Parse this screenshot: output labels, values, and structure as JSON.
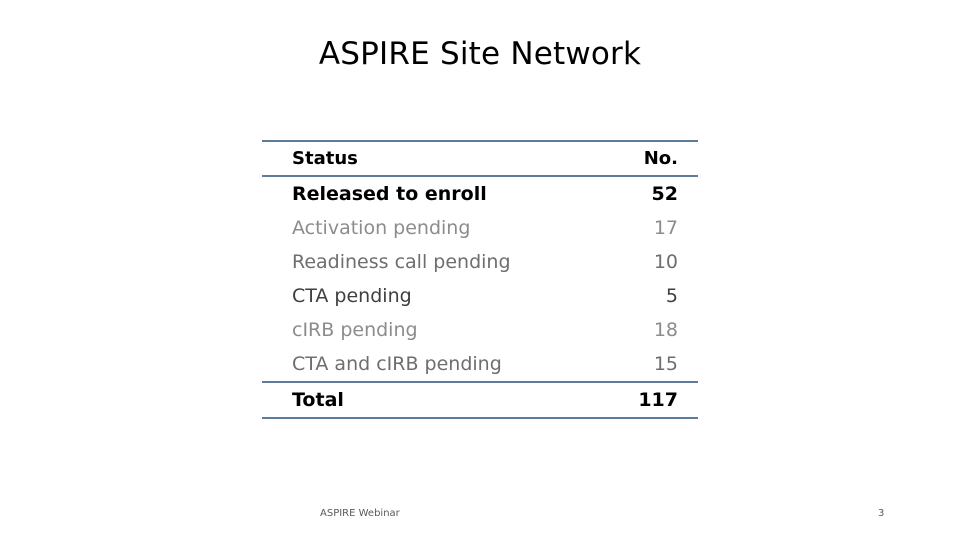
{
  "slide": {
    "title": "ASPIRE Site Network",
    "background_color": "#FFFFFF",
    "rule_color": "#5B7C9D"
  },
  "table": {
    "columns": [
      {
        "key": "status",
        "label": "Status",
        "align": "left"
      },
      {
        "key": "no",
        "label": "No.",
        "align": "right"
      }
    ],
    "rows": [
      {
        "status": "Released to enroll",
        "no": "52",
        "emphasis": "bold",
        "color": "#000000"
      },
      {
        "status": "Activation pending",
        "no": "17",
        "emphasis": "normal",
        "color": "#8C8C8C"
      },
      {
        "status": "Readiness call pending",
        "no": "10",
        "emphasis": "normal",
        "color": "#6E6E6E"
      },
      {
        "status": "CTA pending",
        "no": "5",
        "emphasis": "normal",
        "color": "#3F3F3F"
      },
      {
        "status": "cIRB pending",
        "no": "18",
        "emphasis": "normal",
        "color": "#8C8C8C"
      },
      {
        "status": "CTA and cIRB pending",
        "no": "15",
        "emphasis": "normal",
        "color": "#6E6E6E"
      }
    ],
    "total": {
      "status": "Total",
      "no": "117"
    }
  },
  "footer": {
    "left": "ASPIRE Webinar",
    "page_number": "3"
  }
}
